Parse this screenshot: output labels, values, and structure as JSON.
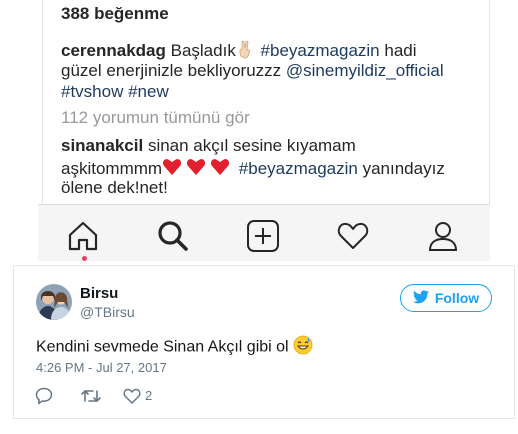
{
  "instagram": {
    "likes": "388 beğenme",
    "caption": {
      "user": "cerennakdag",
      "text1": " Başladık",
      "tag1": " #beyazmagazin",
      "text2": " hadi",
      "line2": "güzel enerjinizle bekliyoruzzz ",
      "mention": "@sinemyildiz_official",
      "tags_line3": "#tvshow #new"
    },
    "view_comments": "112 yorumun tümünü gör",
    "comment": {
      "user": "sinanakcil",
      "text1": " sinan akçıl sesine kıyamam",
      "line2a": "aşkitommmm",
      "tag": "#beyazmagazin",
      "line2b": " yanındayız",
      "line3": "ölene dek!net!"
    },
    "nav_icons": [
      "home-icon",
      "search-icon",
      "new-post-icon",
      "activity-heart-icon",
      "profile-icon"
    ],
    "notification_color": "#e8405a"
  },
  "tweet": {
    "name": "Birsu",
    "handle": "@TBirsu",
    "follow_label": "Follow",
    "text": "Kendini sevmede Sinan Akçıl gibi ol",
    "timestamp": "4:26 PM - Jul 27, 2017",
    "like_count": "2",
    "accent_color": "#1da1f2"
  }
}
